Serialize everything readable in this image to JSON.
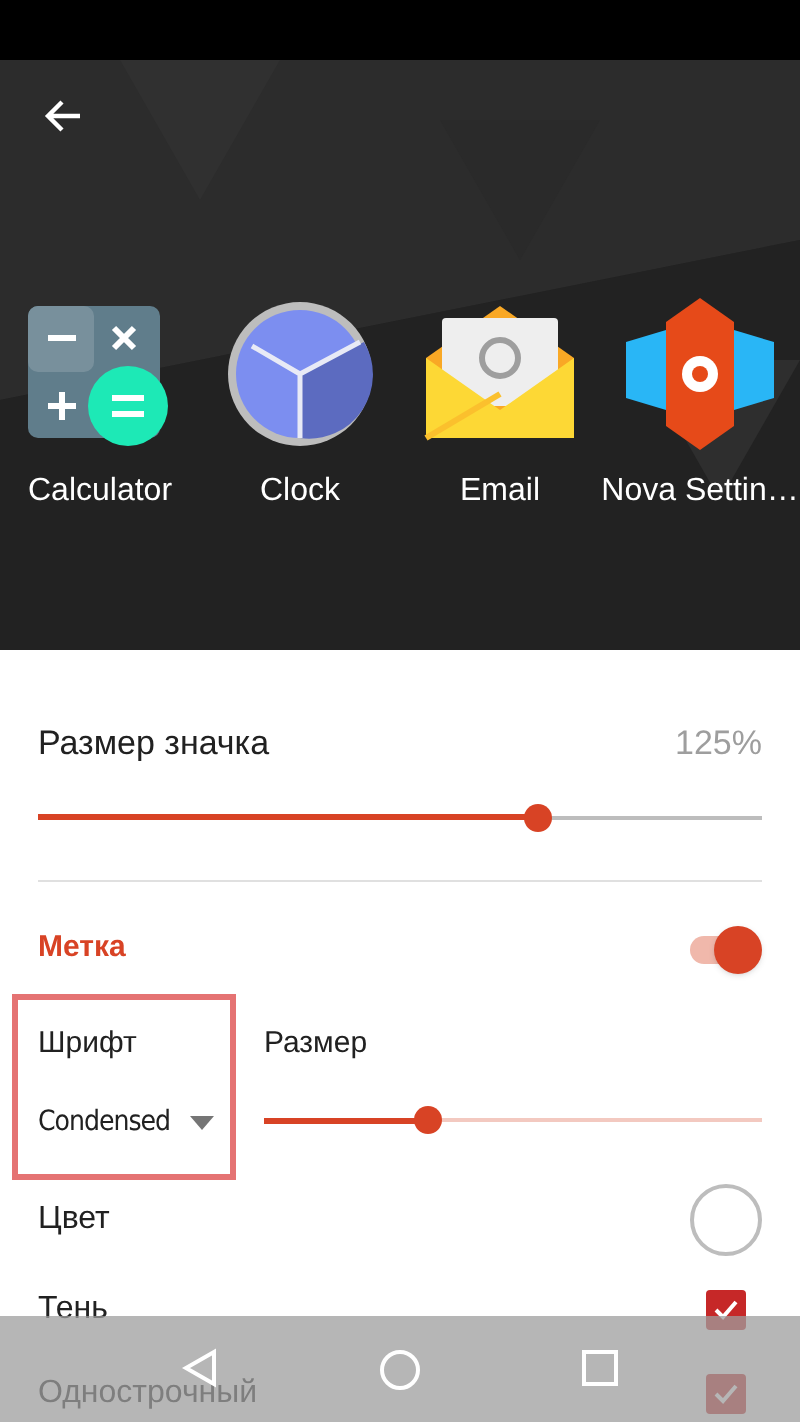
{
  "apps": [
    {
      "kind": "calculator",
      "label": "Calculator"
    },
    {
      "kind": "clock",
      "label": "Clock"
    },
    {
      "kind": "email",
      "label": "Email"
    },
    {
      "kind": "nova",
      "label": "Nova Settin…"
    }
  ],
  "icon_size": {
    "title": "Размер значка",
    "value": "125%",
    "level": 0.69
  },
  "label_section": {
    "title": "Метка",
    "on": true
  },
  "font": {
    "title": "Шрифт",
    "value": "Condensed"
  },
  "size": {
    "title": "Размер",
    "level": 0.33
  },
  "rows": [
    {
      "kind": "color",
      "label": "Цвет"
    },
    {
      "kind": "check",
      "label": "Тень",
      "checked": true
    },
    {
      "kind": "check",
      "label": "Однострочный",
      "checked": true
    }
  ]
}
